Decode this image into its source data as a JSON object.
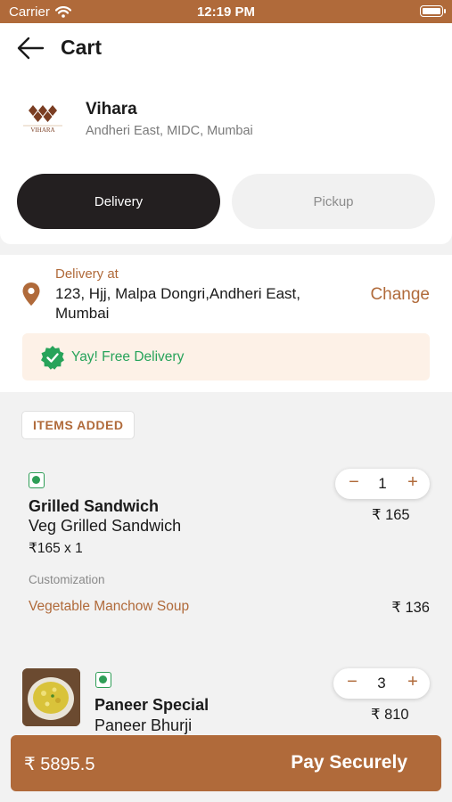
{
  "status_bar": {
    "carrier": "Carrier",
    "time": "12:19 PM"
  },
  "nav": {
    "title": "Cart"
  },
  "restaurant": {
    "name": "Vihara",
    "address": "Andheri East, MIDC, Mumbai",
    "logo_text": "VIHARA"
  },
  "order_type": {
    "delivery_label": "Delivery",
    "pickup_label": "Pickup",
    "selected": "Delivery"
  },
  "delivery": {
    "label": "Delivery at",
    "address": "123, Hjj, Malpa Dongri,Andheri East, Mumbai",
    "change_label": "Change",
    "free_banner": "Yay! Free Delivery"
  },
  "items_section": {
    "label": "ITEMS ADDED"
  },
  "items": [
    {
      "name": "Grilled Sandwich",
      "variant": "Veg Grilled Sandwich",
      "unit_price": "₹165 x 1",
      "quantity": "1",
      "price": "₹ 165",
      "customization_label": "Customization",
      "customization_name": "Vegetable Manchow Soup",
      "customization_price": "₹ 136"
    },
    {
      "name": "Paneer Special",
      "variant": "Paneer Bhurji",
      "quantity": "3",
      "price": "₹ 810"
    }
  ],
  "stepper": {
    "minus": "−",
    "plus": "+"
  },
  "footer": {
    "total": "₹ 5895.5",
    "pay_label": "Pay Securely"
  },
  "colors": {
    "accent": "#b06a3a",
    "veg_green": "#2f9e57",
    "free_green": "#27a35a",
    "dark": "#231f20"
  }
}
